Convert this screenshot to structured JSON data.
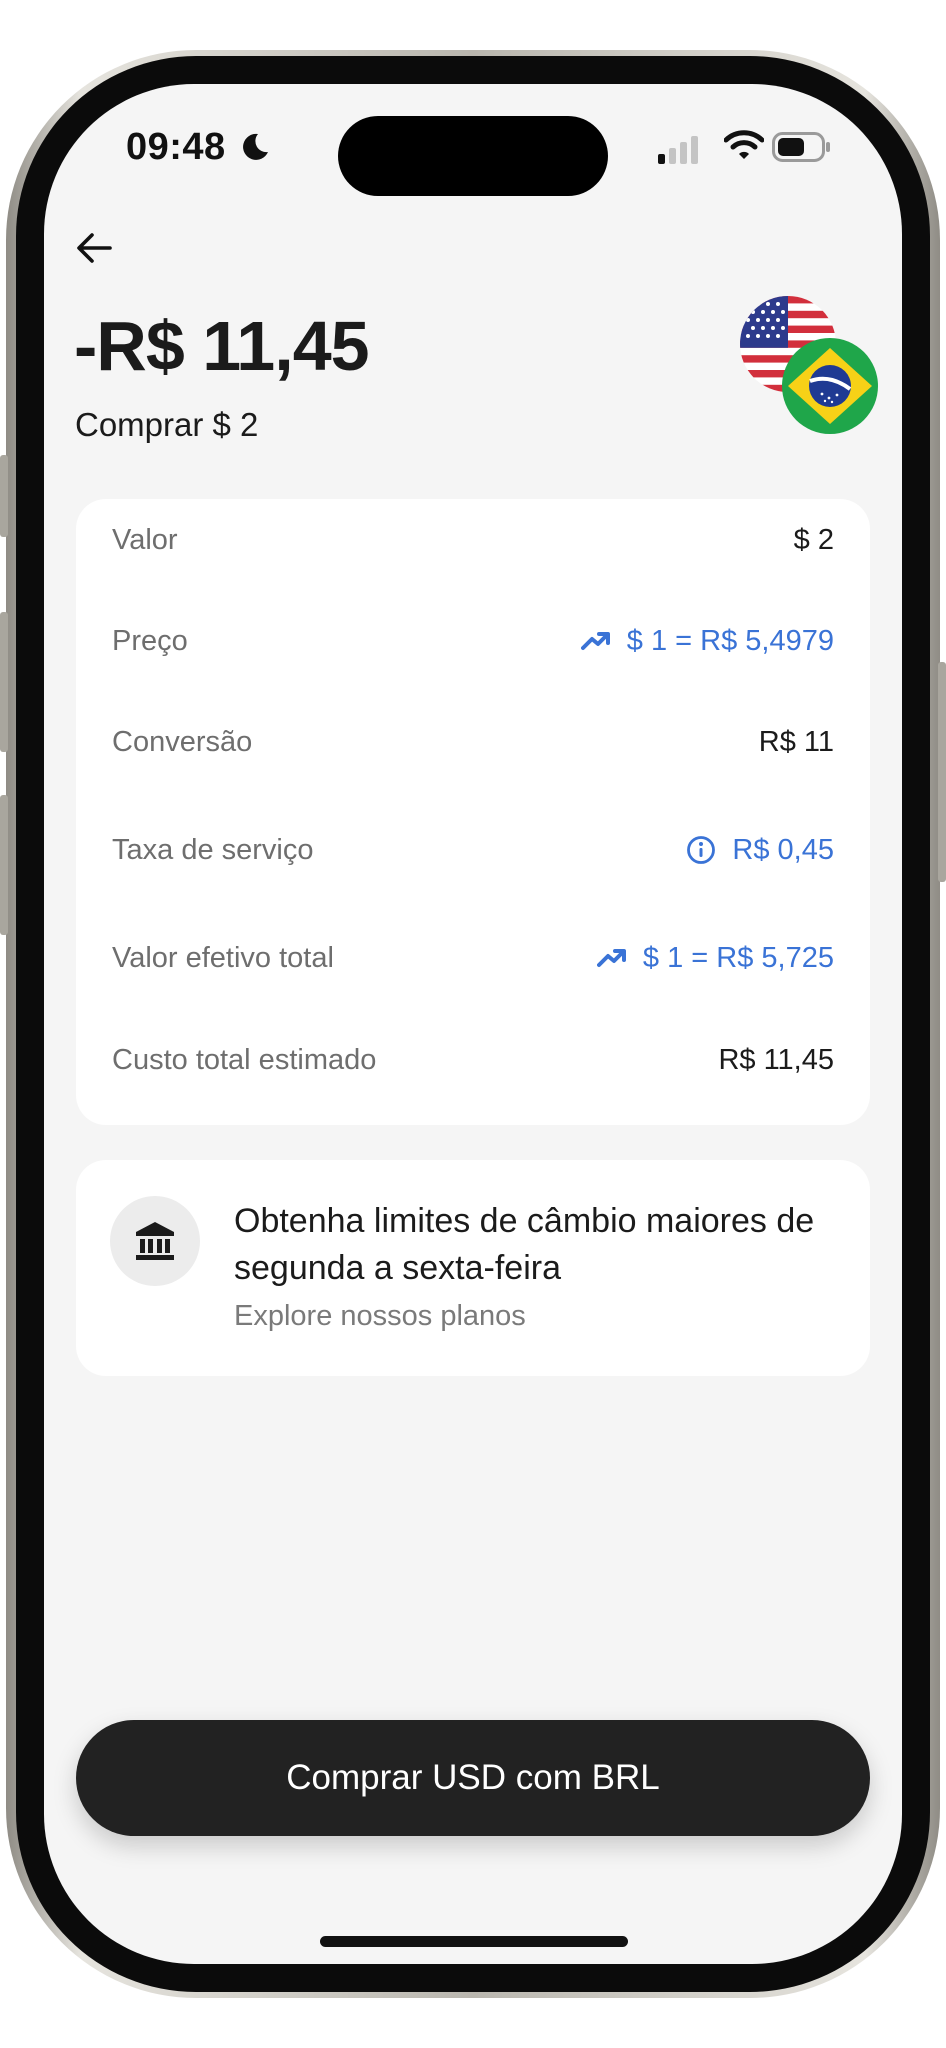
{
  "status_bar": {
    "time": "09:48"
  },
  "header": {
    "amount": "-R$ 11,45",
    "subtitle": "Comprar $ 2"
  },
  "details": [
    {
      "label": "Valor",
      "value": "$ 2"
    },
    {
      "label": "Preço",
      "value": "$ 1 = R$ 5,4979"
    },
    {
      "label": "Conversão",
      "value": "R$ 11"
    },
    {
      "label": "Taxa de serviço",
      "value": "R$ 0,45"
    },
    {
      "label": "Valor efetivo total",
      "value": "$ 1 = R$ 5,725"
    },
    {
      "label": "Custo total estimado",
      "value": "R$ 11,45"
    }
  ],
  "promo": {
    "title": "Obtenha limites de câmbio maiores de segunda a sexta-feira",
    "link": "Explore nossos planos"
  },
  "cta": {
    "label": "Comprar USD com BRL"
  },
  "colors": {
    "accent_blue": "#3a73d6",
    "button_dark": "#222222",
    "background": "#f5f5f5"
  }
}
